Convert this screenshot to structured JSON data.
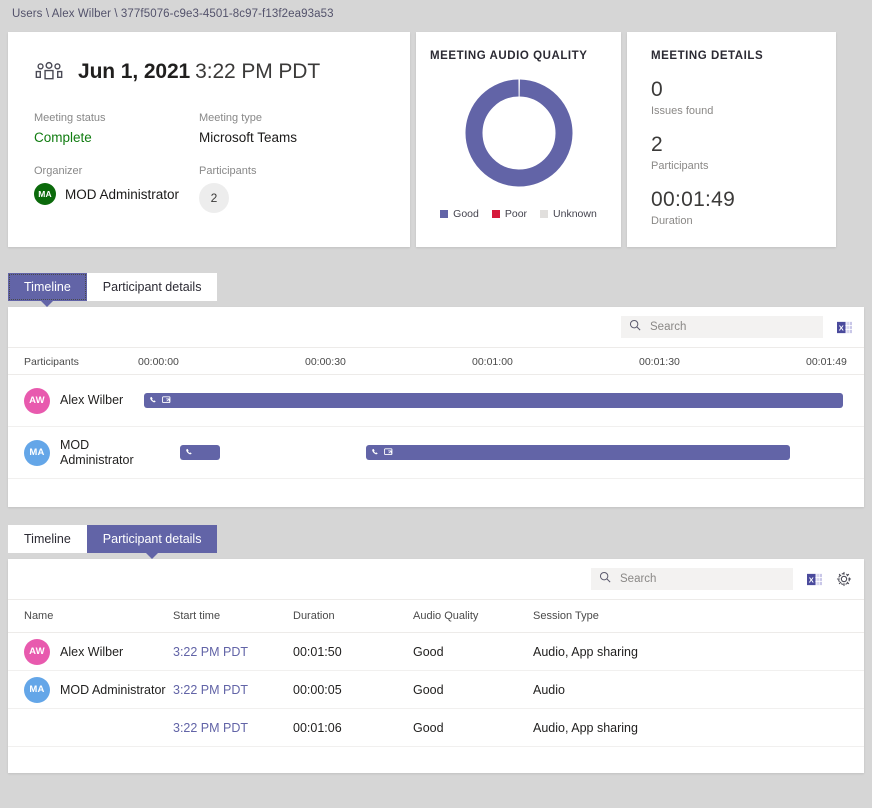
{
  "breadcrumb": {
    "text": "Users \\ Alex Wilber \\ 377f5076-c9e3-4501-8c97-f13f2ea93a53"
  },
  "summary": {
    "icon": "teams-people-icon",
    "date": "Jun 1, 2021",
    "time": "3:22 PM PDT",
    "status_label": "Meeting status",
    "status_value": "Complete",
    "type_label": "Meeting type",
    "type_value": "Microsoft Teams",
    "organizer_label": "Organizer",
    "organizer_initials": "MA",
    "organizer_name": "MOD Administrator",
    "participants_label": "Participants",
    "participants_count": "2"
  },
  "audio_card": {
    "title": "MEETING AUDIO QUALITY",
    "legend": [
      {
        "label": "Good",
        "color": "#6264a7"
      },
      {
        "label": "Poor",
        "color": "#d6193b"
      },
      {
        "label": "Unknown",
        "color": "#e1dfdd"
      }
    ]
  },
  "chart_data": {
    "type": "pie",
    "title": "MEETING AUDIO QUALITY",
    "categories": [
      "Good",
      "Poor",
      "Unknown"
    ],
    "values": [
      100,
      0,
      0
    ],
    "colors": [
      "#6264a7",
      "#d6193b",
      "#e1dfdd"
    ],
    "unit": "percent",
    "donut": true,
    "legend_position": "bottom"
  },
  "details_card": {
    "title": "MEETING DETAILS",
    "items": [
      {
        "value": "0",
        "label": "Issues found"
      },
      {
        "value": "2",
        "label": "Participants"
      },
      {
        "value": "00:01:49",
        "label": "Duration"
      }
    ]
  },
  "tabs_timeline": {
    "items": [
      {
        "label": "Timeline",
        "active": true
      },
      {
        "label": "Participant details",
        "active": false
      }
    ]
  },
  "tabs_participants": {
    "items": [
      {
        "label": "Timeline",
        "active": false
      },
      {
        "label": "Participant details",
        "active": true
      }
    ]
  },
  "search": {
    "placeholder": "Search",
    "value": ""
  },
  "toolbar_icons": {
    "excel": "excel-export-icon",
    "settings": "gear-icon"
  },
  "timeline": {
    "header": {
      "participants_label": "Participants",
      "ticks": [
        "00:00:00",
        "00:00:30",
        "00:01:00",
        "00:01:30",
        "00:01:49"
      ]
    },
    "rows": [
      {
        "initials": "AW",
        "name": "Alex Wilber",
        "avatar_color": "#e85aae",
        "segments": [
          {
            "left_pct": 15.6,
            "width_pct": 81.2,
            "icons": [
              "phone-icon",
              "screen-share-icon"
            ]
          }
        ]
      },
      {
        "initials": "MA",
        "name": "MOD Administrator",
        "avatar_color": "#64a6e8",
        "segments": [
          {
            "left_pct": 19.8,
            "width_pct": 4.6,
            "icons": [
              "phone-icon"
            ]
          },
          {
            "left_pct": 41.6,
            "width_pct": 49.5,
            "icons": [
              "phone-icon",
              "screen-share-icon"
            ]
          }
        ]
      }
    ]
  },
  "participant_table": {
    "columns": [
      "Name",
      "Start time",
      "Duration",
      "Audio Quality",
      "Session Type"
    ],
    "rows": [
      {
        "initials": "AW",
        "name": "Alex Wilber",
        "avatar_color": "#e85aae",
        "start_time": "3:22 PM PDT",
        "duration": "00:01:50",
        "audio_quality": "Good",
        "session_type": "Audio, App sharing"
      },
      {
        "initials": "MA",
        "name": "MOD Administrator",
        "avatar_color": "#64a6e8",
        "start_time": "3:22 PM PDT",
        "duration": "00:00:05",
        "audio_quality": "Good",
        "session_type": "Audio"
      },
      {
        "initials": "",
        "name": "",
        "avatar_color": "",
        "start_time": "3:22 PM PDT",
        "duration": "00:01:06",
        "audio_quality": "Good",
        "session_type": "Audio, App sharing"
      }
    ]
  }
}
